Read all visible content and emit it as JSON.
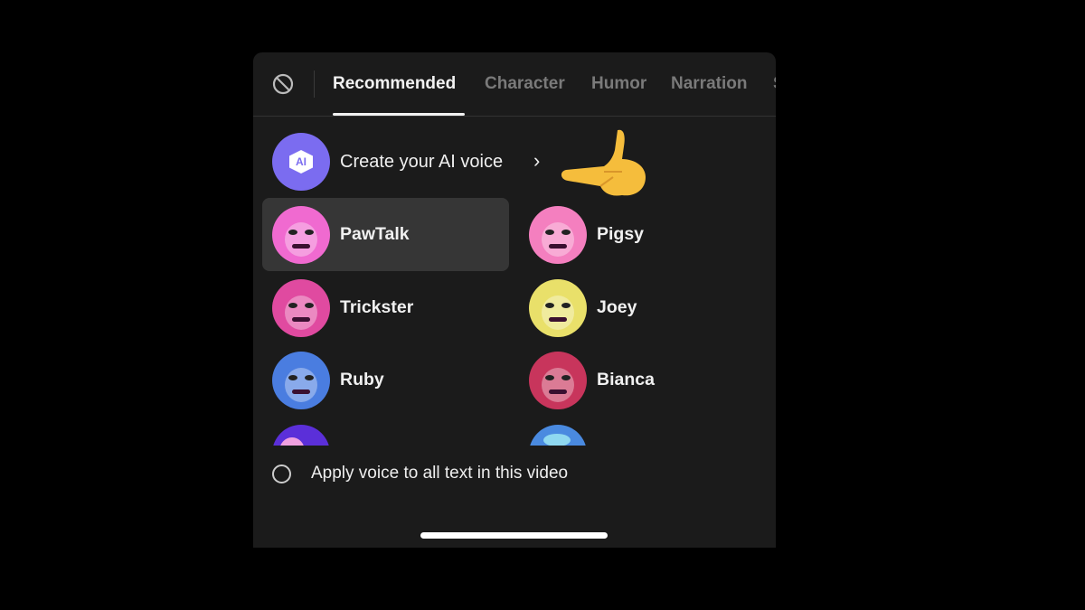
{
  "tabs": {
    "none_icon": "ban-icon",
    "items": [
      {
        "label": "Recommended",
        "active": true
      },
      {
        "label": "Character",
        "active": false
      },
      {
        "label": "Humor",
        "active": false
      },
      {
        "label": "Narration",
        "active": false
      },
      {
        "label": "S",
        "active": false
      }
    ]
  },
  "create_ai": {
    "badge": "AI",
    "label": "Create your AI voice",
    "chevron": "›",
    "accent": "#7b6cf0",
    "pointer_icon": "pointing-hand-emoji"
  },
  "voices": [
    {
      "name": "PawTalk",
      "selected": true,
      "color": "#f06ad0"
    },
    {
      "name": "Pigsy",
      "selected": false,
      "color": "#f47fbf"
    },
    {
      "name": "Trickster",
      "selected": false,
      "color": "#e04aa0"
    },
    {
      "name": "Joey",
      "selected": false,
      "color": "#e9e06a"
    },
    {
      "name": "Ruby",
      "selected": false,
      "color": "#4a7de0"
    },
    {
      "name": "Bianca",
      "selected": false,
      "color": "#c8355c"
    }
  ],
  "apply_all": {
    "label": "Apply voice to all text in this video",
    "checked": false
  }
}
